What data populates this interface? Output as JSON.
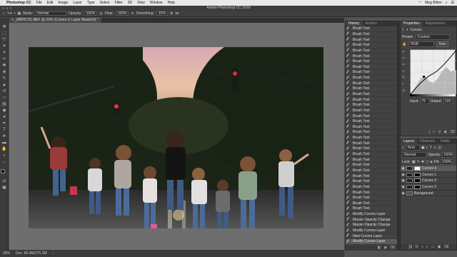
{
  "menubar": {
    "apple": "",
    "app_name": "Photoshop CC",
    "items": [
      "File",
      "Edit",
      "Image",
      "Layer",
      "Type",
      "Select",
      "Filter",
      "3D",
      "View",
      "Window",
      "Help"
    ],
    "user": "Meg Bilton"
  },
  "window": {
    "title": "Adobe Photoshop CC 2018"
  },
  "options": {
    "mode_label": "Mode:",
    "mode_value": "Normal",
    "opacity_label": "Opacity:",
    "opacity_value": "100%",
    "flow_label": "Flow:",
    "flow_value": "100%",
    "smoothing_label": "Smoothing:",
    "smoothing_value": "10%"
  },
  "document": {
    "tab_title": "_MBP5721.NEF @ 25% (Curves 4, Layer Mask/16) *",
    "zoom": "25%",
    "doc_info": "Doc: 86.4M/275.2M"
  },
  "history": {
    "tabs": [
      "History",
      "Actions"
    ],
    "items": [
      "Brush Tool",
      "Brush Tool",
      "Brush Tool",
      "Brush Tool",
      "Brush Tool",
      "Brush Tool",
      "Brush Tool",
      "Brush Tool",
      "Brush Tool",
      "Brush Tool",
      "Brush Tool",
      "Brush Tool",
      "Brush Tool",
      "Brush Tool",
      "Brush Tool",
      "Brush Tool",
      "Brush Tool",
      "Brush Tool",
      "Brush Tool",
      "Brush Tool",
      "Brush Tool",
      "Brush Tool",
      "Brush Tool",
      "Brush Tool",
      "Brush Tool",
      "Brush Tool",
      "Brush Tool",
      "Brush Tool",
      "Brush Tool",
      "Brush Tool",
      "Brush Tool",
      "Brush Tool",
      "Brush Tool",
      "Brush Tool",
      "Modify Curves Layer",
      "Master Opacity Change",
      "Master Opacity Change",
      "Modify Curves Layer",
      "New Curves Layer",
      "Modify Curves Layer"
    ]
  },
  "properties": {
    "tabs": [
      "Properties",
      "Adjustments"
    ],
    "title": "Curves",
    "preset_label": "Preset:",
    "preset_value": "Custom",
    "channel_value": "RGB",
    "auto_label": "Auto",
    "input_label": "Input:",
    "input_value": "76",
    "output_label": "Output:",
    "output_value": "102"
  },
  "layers": {
    "tabs": [
      "Layers",
      "Channels",
      "Paths"
    ],
    "kind_label": "Kind",
    "blend_value": "Normal",
    "opacity_label": "Opacity:",
    "opacity_value": "100%",
    "lock_label": "Lock:",
    "fill_label": "Fill:",
    "fill_value": "100%",
    "items": [
      {
        "name": "Curves 4",
        "mask": "white"
      },
      {
        "name": "Curves 1",
        "mask": "black"
      },
      {
        "name": "Curves 3",
        "mask": "black"
      },
      {
        "name": "Curves 2",
        "mask": "black"
      },
      {
        "name": "Background",
        "mask": "none"
      }
    ],
    "footer_icons": [
      "link-icon",
      "fx-icon",
      "mask-icon",
      "adjustment-icon",
      "group-icon",
      "new-layer-icon",
      "trash-icon"
    ]
  },
  "colors": {
    "accent": "#5b5b5b",
    "sky_pink": "#e3b4b0"
  }
}
